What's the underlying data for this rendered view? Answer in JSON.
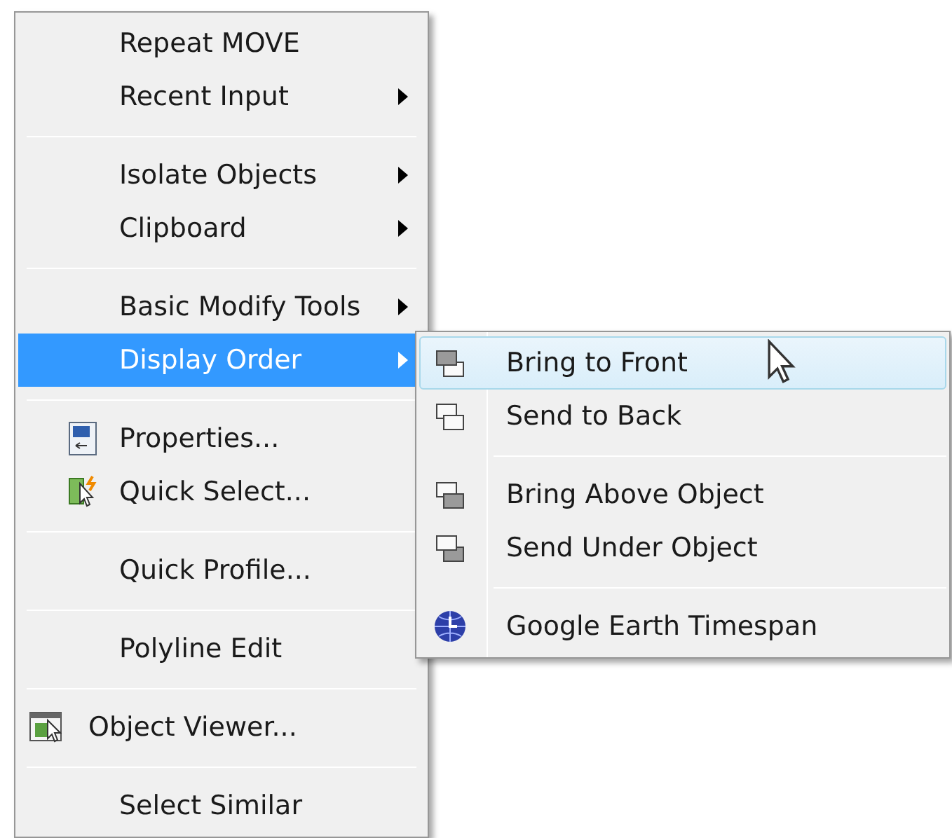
{
  "context_menu": {
    "items": [
      {
        "kind": "text",
        "label": "Repeat MOVE",
        "submenu": false,
        "selected": false
      },
      {
        "kind": "text",
        "label": "Recent Input",
        "submenu": true,
        "selected": false
      },
      {
        "kind": "separator"
      },
      {
        "kind": "text",
        "label": "Isolate Objects",
        "submenu": true,
        "selected": false
      },
      {
        "kind": "text",
        "label": "Clipboard",
        "submenu": true,
        "selected": false
      },
      {
        "kind": "separator"
      },
      {
        "kind": "text",
        "label": "Basic Modify Tools",
        "submenu": true,
        "selected": false
      },
      {
        "kind": "text",
        "label": "Display Order",
        "submenu": true,
        "selected": true
      },
      {
        "kind": "separator"
      },
      {
        "kind": "icon",
        "label": "Properties...",
        "submenu": false,
        "selected": false
      },
      {
        "kind": "icon",
        "label": "Quick Select...",
        "submenu": false,
        "selected": false
      },
      {
        "kind": "separator"
      },
      {
        "kind": "text",
        "label": "Quick Profile...",
        "submenu": false,
        "selected": false
      },
      {
        "kind": "separator"
      },
      {
        "kind": "text",
        "label": "Polyline Edit",
        "submenu": false,
        "selected": false
      },
      {
        "kind": "separator"
      },
      {
        "kind": "wide-icon",
        "label": "Object Viewer...",
        "submenu": false,
        "selected": false
      },
      {
        "kind": "separator"
      },
      {
        "kind": "text",
        "label": "Select Similar",
        "submenu": false,
        "selected": false
      }
    ]
  },
  "submenu": {
    "items": [
      {
        "kind": "item",
        "label": "Bring to Front",
        "selected": true
      },
      {
        "kind": "item",
        "label": "Send to Back",
        "selected": false
      },
      {
        "kind": "separator"
      },
      {
        "kind": "item",
        "label": "Bring Above Object",
        "selected": false
      },
      {
        "kind": "item",
        "label": "Send Under Object",
        "selected": false
      },
      {
        "kind": "separator"
      },
      {
        "kind": "item",
        "label": "Google Earth Timespan",
        "selected": false
      }
    ]
  }
}
